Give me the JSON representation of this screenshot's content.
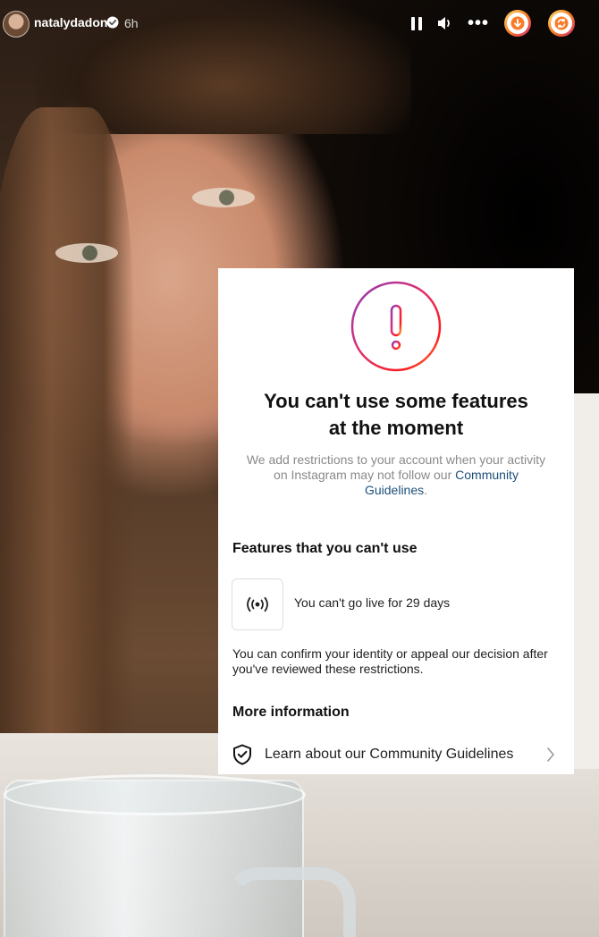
{
  "story": {
    "username": "natalydadon",
    "time": "6h"
  },
  "controls": {
    "pause_icon": "pause-icon",
    "volume_icon": "speaker-icon",
    "more_label": "•••"
  },
  "restriction_card": {
    "title_line1": "You can't use some features",
    "title_line2": "at the moment",
    "desc_text": "We add restrictions to your account when your activity on Instagram may not follow our",
    "desc_link": "Community Guidelines",
    "desc_end": ".",
    "features_heading": "Features that you can't use",
    "live_restriction": "You can't go live for 29 days",
    "confirm_text": "You can confirm your identity or appeal our decision after you've reviewed these restrictions.",
    "more_heading": "More information",
    "learn_link": "Learn about our Community Guidelines"
  },
  "colors": {
    "link": "#1d4f7c",
    "gradient_start": "#feda75",
    "gradient_mid": "#fa7e1e",
    "gradient_end": "#d62976"
  }
}
